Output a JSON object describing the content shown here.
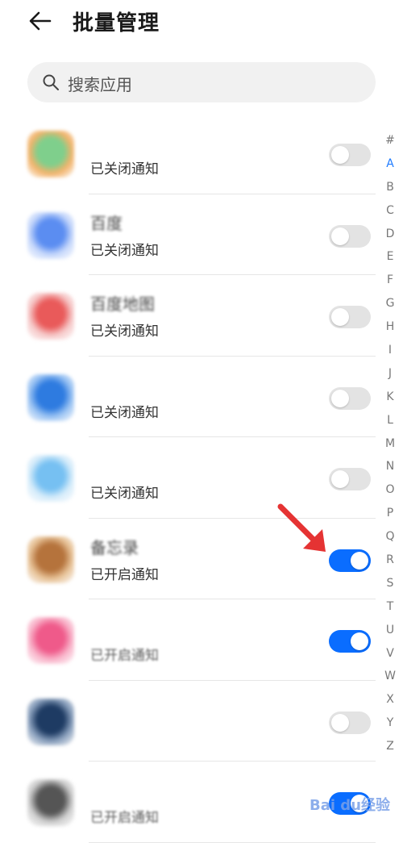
{
  "header": {
    "title": "批量管理"
  },
  "search": {
    "placeholder": "搜索应用"
  },
  "apps": [
    {
      "name": "",
      "status": "已关闭通知",
      "enabled": false,
      "icon_colors": [
        "#7fcf8c",
        "#f2b36b"
      ]
    },
    {
      "name": "百度",
      "status": "已关闭通知",
      "enabled": false,
      "icon_colors": [
        "#5b8df1",
        "#c7d8fb"
      ]
    },
    {
      "name": "百度地图",
      "status": "已关闭通知",
      "enabled": false,
      "icon_colors": [
        "#e95a5a",
        "#f6c9c9"
      ]
    },
    {
      "name": "",
      "status": "已关闭通知",
      "enabled": false,
      "icon_colors": [
        "#2e7be0",
        "#9cc4f3"
      ]
    },
    {
      "name": "",
      "status": "已关闭通知",
      "enabled": false,
      "icon_colors": [
        "#76c0f2",
        "#d6ecfa"
      ]
    },
    {
      "name": "备忘录",
      "status": "已开启通知",
      "enabled": true,
      "icon_colors": [
        "#b5733c",
        "#e8c49a"
      ]
    },
    {
      "name": "",
      "status": "已开启通知",
      "enabled": true,
      "icon_colors": [
        "#ef5a8a",
        "#f9b7cc"
      ]
    },
    {
      "name": "",
      "status": "",
      "enabled": false,
      "icon_colors": [
        "#1e3b63",
        "#8aa0bd"
      ]
    },
    {
      "name": "",
      "status": "已开启通知",
      "enabled": true,
      "icon_colors": [
        "#555555",
        "#cfcfcf"
      ]
    }
  ],
  "index_letters": [
    "#",
    "A",
    "B",
    "C",
    "D",
    "E",
    "F",
    "G",
    "H",
    "I",
    "J",
    "K",
    "L",
    "M",
    "N",
    "O",
    "P",
    "Q",
    "R",
    "S",
    "T",
    "U",
    "V",
    "W",
    "X",
    "Y",
    "Z"
  ],
  "active_letter": "A",
  "accent_color": "#0a6dff",
  "watermark": "Bai du经验"
}
